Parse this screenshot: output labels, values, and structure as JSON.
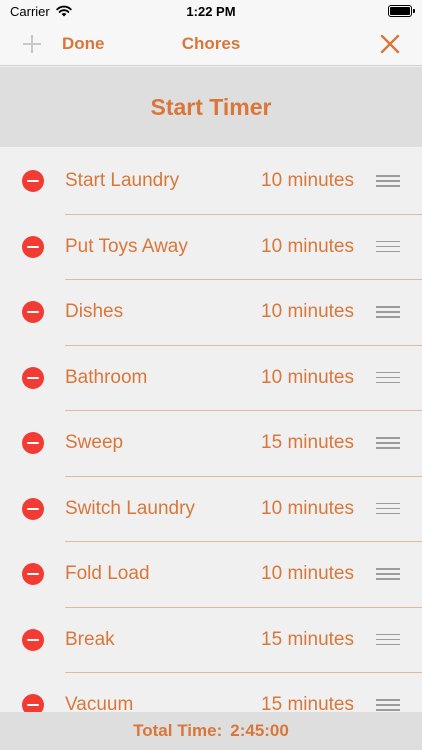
{
  "status_bar": {
    "carrier": "Carrier",
    "time": "1:22 PM"
  },
  "nav": {
    "done_label": "Done",
    "title": "Chores",
    "add_icon": "plus-icon",
    "close_icon": "close-icon"
  },
  "start_timer_label": "Start Timer",
  "chores": [
    {
      "name": "Start Laundry",
      "duration": "10 minutes"
    },
    {
      "name": "Put Toys Away",
      "duration": "10 minutes"
    },
    {
      "name": "Dishes",
      "duration": "10 minutes"
    },
    {
      "name": "Bathroom",
      "duration": "10 minutes"
    },
    {
      "name": "Sweep",
      "duration": "15 minutes"
    },
    {
      "name": "Switch Laundry",
      "duration": "10 minutes"
    },
    {
      "name": "Fold Load",
      "duration": "10 minutes"
    },
    {
      "name": "Break",
      "duration": "15 minutes"
    },
    {
      "name": "Vacuum",
      "duration": "15 minutes"
    }
  ],
  "footer": {
    "label": "Total Time:",
    "value": "2:45:00"
  },
  "colors": {
    "accent": "#d9773a",
    "delete": "#f23b32",
    "header_bg": "#dedede",
    "list_bg": "#f0f0f0"
  }
}
